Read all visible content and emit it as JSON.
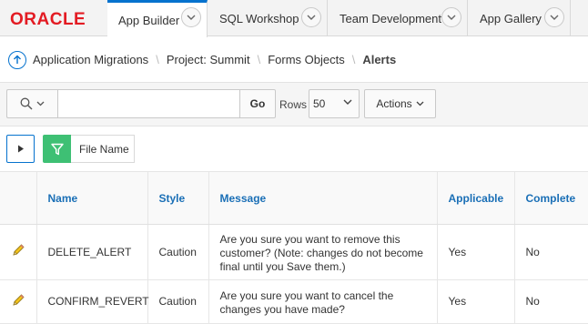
{
  "header": {
    "logo_text": "ORACLE",
    "tabs": [
      {
        "label": "App Builder",
        "active": true
      },
      {
        "label": "SQL Workshop",
        "active": false
      },
      {
        "label": "Team Development",
        "active": false
      },
      {
        "label": "App Gallery",
        "active": false
      }
    ]
  },
  "breadcrumb": {
    "items": [
      "Application Migrations",
      "Project: Summit",
      "Forms Objects",
      "Alerts"
    ]
  },
  "toolbar": {
    "search_placeholder": "",
    "go_label": "Go",
    "rows_label": "Rows",
    "rows_value": "50",
    "actions_label": "Actions"
  },
  "filter": {
    "label": "File Name"
  },
  "table": {
    "columns": [
      "Name",
      "Style",
      "Message",
      "Applicable",
      "Complete"
    ],
    "rows": [
      {
        "name": "DELETE_ALERT",
        "style": "Caution",
        "message": "Are you sure you want to remove this customer? (Note: changes do not become final until you Save them.)",
        "applicable": "Yes",
        "complete": "No"
      },
      {
        "name": "CONFIRM_REVERT",
        "style": "Caution",
        "message": "Are you sure you want to cancel the changes you have made?",
        "applicable": "Yes",
        "complete": "No"
      }
    ]
  },
  "colors": {
    "accent": "#0572ce",
    "brand": "#e31b23",
    "filter_green": "#3ec074",
    "header_text": "#1a6fb6"
  },
  "icons": [
    "chevron-down-icon",
    "up-arrow-icon",
    "search-icon",
    "play-icon",
    "filter-icon",
    "pencil-icon"
  ]
}
